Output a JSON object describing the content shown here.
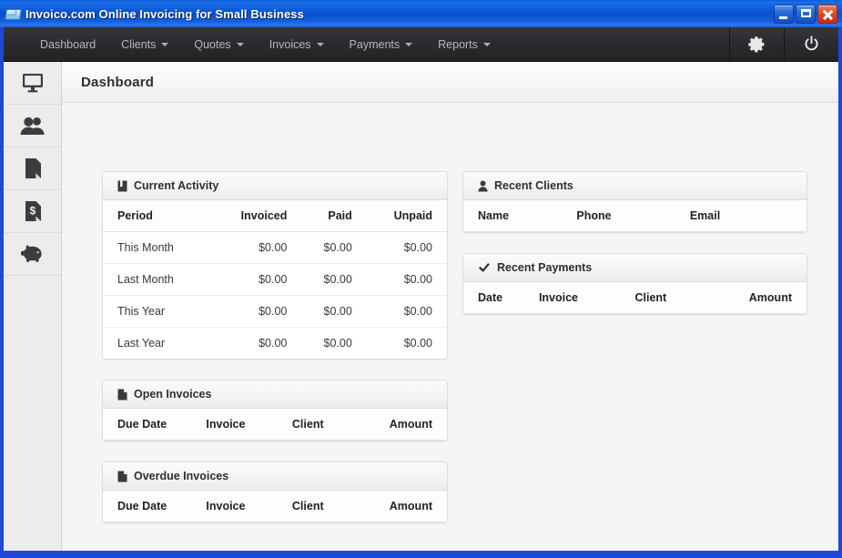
{
  "window": {
    "title": "Invoico.com Online Invoicing for Small Business",
    "app_icon": "envelope-icon",
    "controls": {
      "minimize": "minimize-button",
      "maximize": "maximize-button",
      "close": "close-button"
    },
    "titlebar_color": "#0b58d4"
  },
  "nav": {
    "items": [
      {
        "label": "Dashboard",
        "has_caret": false
      },
      {
        "label": "Clients",
        "has_caret": true
      },
      {
        "label": "Quotes",
        "has_caret": true
      },
      {
        "label": "Invoices",
        "has_caret": true
      },
      {
        "label": "Payments",
        "has_caret": true
      },
      {
        "label": "Reports",
        "has_caret": true
      }
    ],
    "settings_icon": "gear-icon",
    "logout_icon": "power-icon",
    "background_color": "#2c2c30",
    "text_color": "#b6b6b6"
  },
  "sidebar": {
    "items": [
      {
        "icon": "monitor-icon",
        "name": "dashboard"
      },
      {
        "icon": "users-icon",
        "name": "clients"
      },
      {
        "icon": "document-icon",
        "name": "quotes"
      },
      {
        "icon": "dollar-document-icon",
        "name": "invoices"
      },
      {
        "icon": "piggy-bank-icon",
        "name": "payments"
      }
    ],
    "background_color": "#ececec"
  },
  "page": {
    "title": "Dashboard"
  },
  "panels": {
    "current_activity": {
      "title": "Current Activity",
      "icon": "book-icon",
      "columns": [
        "Period",
        "Invoiced",
        "Paid",
        "Unpaid"
      ],
      "rows": [
        {
          "period": "This Month",
          "invoiced": "$0.00",
          "paid": "$0.00",
          "unpaid": "$0.00"
        },
        {
          "period": "Last Month",
          "invoiced": "$0.00",
          "paid": "$0.00",
          "unpaid": "$0.00"
        },
        {
          "period": "This Year",
          "invoiced": "$0.00",
          "paid": "$0.00",
          "unpaid": "$0.00"
        },
        {
          "period": "Last Year",
          "invoiced": "$0.00",
          "paid": "$0.00",
          "unpaid": "$0.00"
        }
      ]
    },
    "open_invoices": {
      "title": "Open Invoices",
      "icon": "file-icon",
      "columns": [
        "Due Date",
        "Invoice",
        "Client",
        "Amount"
      ],
      "rows": []
    },
    "overdue_invoices": {
      "title": "Overdue Invoices",
      "icon": "file-icon",
      "columns": [
        "Due Date",
        "Invoice",
        "Client",
        "Amount"
      ],
      "rows": []
    },
    "recent_clients": {
      "title": "Recent Clients",
      "icon": "person-icon",
      "columns": [
        "Name",
        "Phone",
        "Email"
      ],
      "rows": []
    },
    "recent_payments": {
      "title": "Recent Payments",
      "icon": "check-icon",
      "columns": [
        "Date",
        "Invoice",
        "Client",
        "Amount"
      ],
      "rows": []
    }
  }
}
